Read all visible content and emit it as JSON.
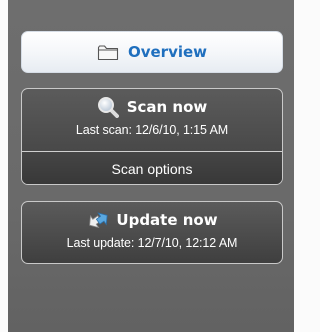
{
  "sidebar": {
    "overview": {
      "label": "Overview",
      "icon": "folder-icon",
      "label_color": "#1f6fbe"
    },
    "scan": {
      "title": "Scan now",
      "icon": "magnifier-icon",
      "last_scan": "Last scan: 12/6/10, 1:15 AM",
      "options_label": "Scan options"
    },
    "update": {
      "title": "Update now",
      "icon": "update-arrows-icon",
      "last_update": "Last update: 12/7/10, 12:12 AM"
    }
  }
}
